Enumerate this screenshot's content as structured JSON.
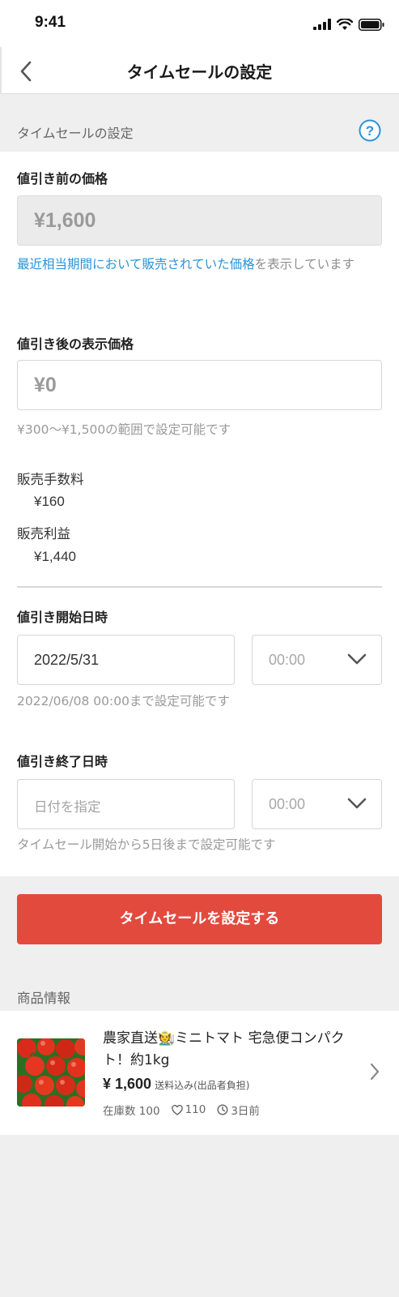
{
  "status_bar": {
    "time": "9:41"
  },
  "nav": {
    "title": "タイムセールの設定"
  },
  "section": {
    "label": "タイムセールの設定"
  },
  "original_price": {
    "label": "値引き前の価格",
    "value": "¥1,600",
    "note_link": "最近相当期間において販売されていた価格",
    "note_rest": "を表示しています"
  },
  "sale_price": {
    "label": "値引き後の表示価格",
    "placeholder": "¥0",
    "hint": "¥300〜¥1,500の範囲で設定可能です"
  },
  "fees": {
    "fee_label": "販売手数料",
    "fee_value": "¥160",
    "profit_label": "販売利益",
    "profit_value": "¥1,440"
  },
  "start": {
    "label": "値引き開始日時",
    "date": "2022/5/31",
    "time": "00:00",
    "hint": "2022/06/08 00:00まで設定可能です"
  },
  "end": {
    "label": "値引き終了日時",
    "date_placeholder": "日付を指定",
    "time": "00:00",
    "hint": "タイムセール開始から5日後まで設定可能です"
  },
  "cta": {
    "label": "タイムセールを設定する"
  },
  "product": {
    "header": "商品情報",
    "title": "農家直送🧑‍🌾ミニトマト 宅急便コンパクト！約1kg",
    "price": "¥ 1,600",
    "price_note": "送料込み(出品者負担)",
    "stock": "在庫数 100",
    "likes": "110",
    "time_ago": "3日前"
  },
  "colors": {
    "accent": "#e34a3e",
    "link": "#2a93d5"
  },
  "icons": [
    "back-arrow-icon",
    "help-icon",
    "chevron-down-icon",
    "heart-icon",
    "clock-icon",
    "chevron-right-icon"
  ]
}
